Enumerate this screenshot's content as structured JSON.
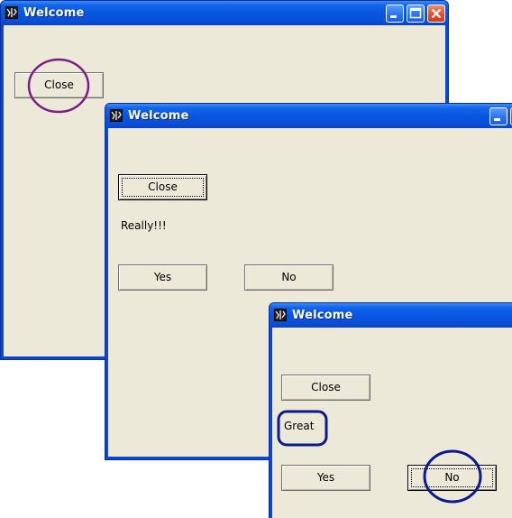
{
  "windows": [
    {
      "title": "Welcome",
      "close_label": "Close"
    },
    {
      "title": "Welcome",
      "close_label": "Close",
      "message": "Really!!!",
      "yes_label": "Yes",
      "no_label": "No"
    },
    {
      "title": "Welcome",
      "close_label": "Close",
      "message": "Great",
      "yes_label": "Yes",
      "no_label": "No"
    }
  ],
  "annotation_colors": {
    "close_circle": "#7a1f8a",
    "great_and_no": "#0c1a8c"
  }
}
